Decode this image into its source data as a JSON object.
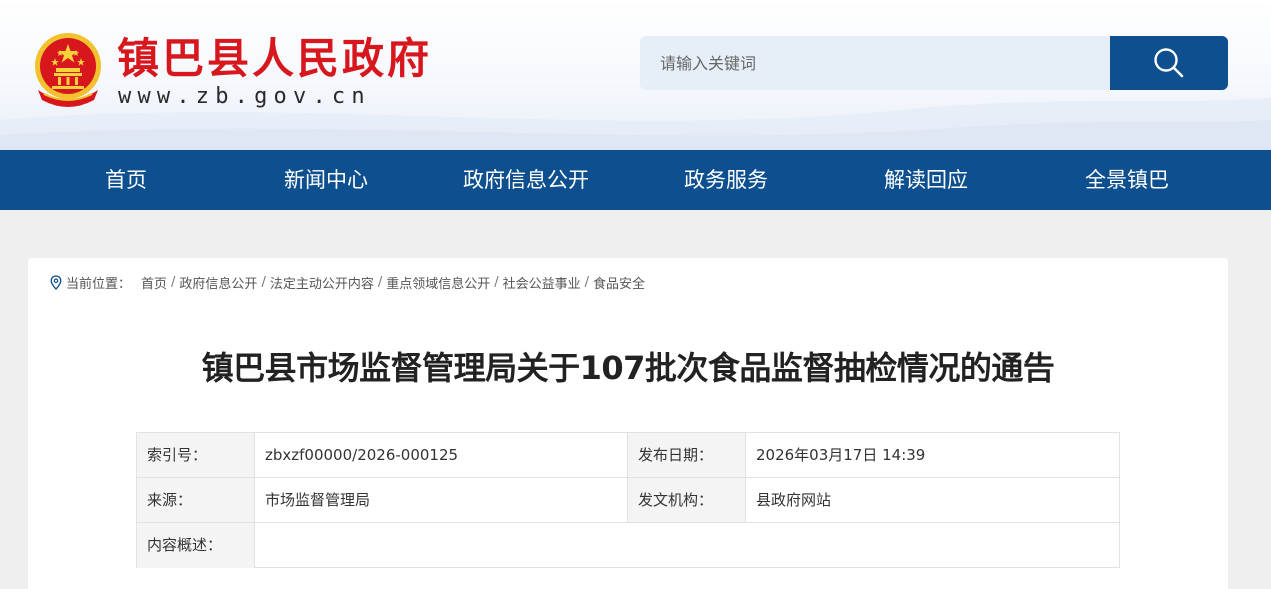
{
  "header": {
    "site_name": "镇巴县人民政府",
    "site_url": "www.zb.gov.cn",
    "emblem_icon": "national-emblem-icon",
    "search": {
      "placeholder": "请输入关键词",
      "button_icon": "search-icon"
    }
  },
  "nav": {
    "items": [
      {
        "label": "首页"
      },
      {
        "label": "新闻中心"
      },
      {
        "label": "政府信息公开"
      },
      {
        "label": "政务服务"
      },
      {
        "label": "解读回应"
      },
      {
        "label": "全景镇巴"
      }
    ]
  },
  "breadcrumb": {
    "icon": "location-pin-icon",
    "label": "当前位置：",
    "items": [
      "首页",
      "政府信息公开",
      "法定主动公开内容",
      "重点领域信息公开",
      "社会公益事业",
      "食品安全"
    ],
    "separator": "/"
  },
  "article": {
    "title": "镇巴县市场监督管理局关于107批次食品监督抽检情况的通告"
  },
  "meta": {
    "index_label": "索引号：",
    "index_value": "zbxzf00000/2026-000125",
    "date_label": "发布日期：",
    "date_value": "2026年03月17日 14:39",
    "source_label": "来源：",
    "source_value": "市场监督管理局",
    "issuer_label": "发文机构：",
    "issuer_value": "县政府网站",
    "summary_label": "内容概述：",
    "summary_value": ""
  },
  "colors": {
    "brand_blue": "#0d4f8f",
    "brand_red": "#d7171d",
    "search_bg": "#e6eef7",
    "page_bg": "#efefef"
  }
}
